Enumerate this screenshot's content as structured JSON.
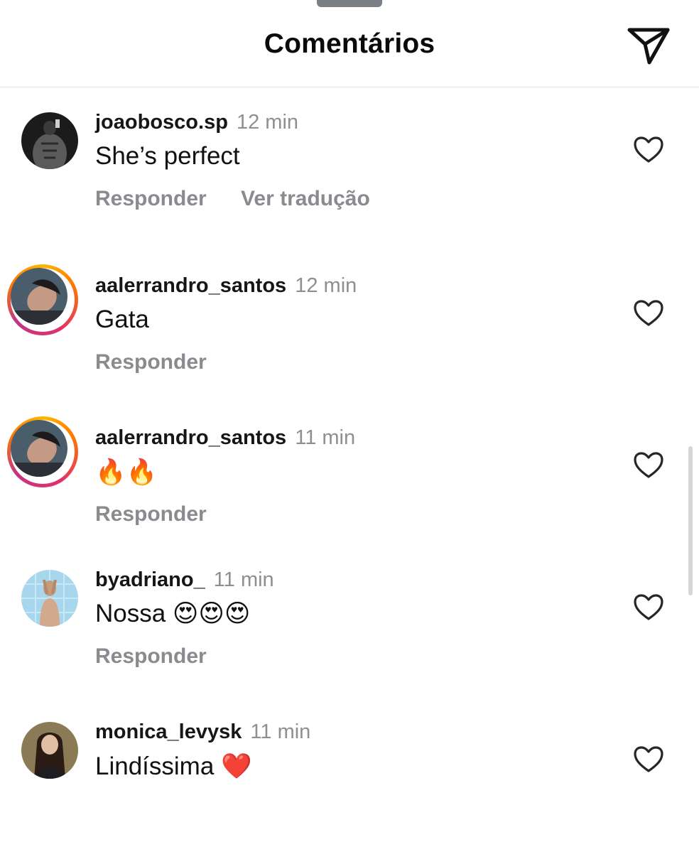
{
  "header": {
    "title": "Comentários",
    "send_icon": "paper-plane-icon"
  },
  "comments": [
    {
      "username": "joaobosco.sp",
      "time": "12 min",
      "text": "She’s perfect",
      "reply_label": "Responder",
      "translate_label": "Ver tradução",
      "like_icon": "heart-outline-icon",
      "story_ring": false
    },
    {
      "username": "aalerrandro_santos",
      "time": "12 min",
      "text": "Gata",
      "reply_label": "Responder",
      "like_icon": "heart-outline-icon",
      "story_ring": true
    },
    {
      "username": "aalerrandro_santos",
      "time": "11 min",
      "text": "🔥🔥",
      "reply_label": "Responder",
      "like_icon": "heart-outline-icon",
      "story_ring": true
    },
    {
      "username": "byadriano_",
      "time": "11 min",
      "text": "Nossa 😍😍😍",
      "reply_label": "Responder",
      "like_icon": "heart-outline-icon",
      "story_ring": false
    },
    {
      "username": "monica_levysk",
      "time": "11 min",
      "text": "Lindíssima ❤️",
      "like_icon": "heart-outline-icon",
      "story_ring": false
    }
  ],
  "colors": {
    "muted_text": "#8e8e93",
    "story_ring_start": "#ffb800",
    "story_ring_end": "#c13584"
  }
}
